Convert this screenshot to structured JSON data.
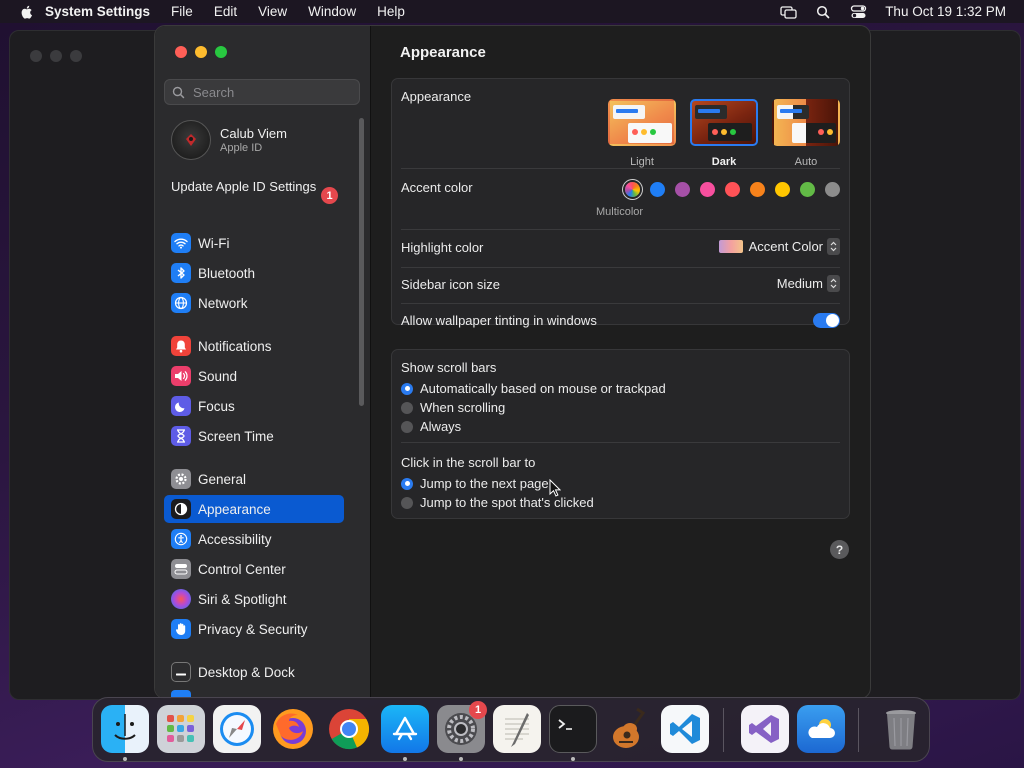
{
  "menubar": {
    "app_name": "System Settings",
    "menus": [
      "File",
      "Edit",
      "View",
      "Window",
      "Help"
    ],
    "clock": "Thu Oct 19  1:32 PM"
  },
  "sidebar": {
    "search_placeholder": "Search",
    "account": {
      "name": "Calub Viem",
      "subtitle": "Apple ID"
    },
    "update_notice": {
      "label": "Update Apple ID Settings",
      "badge": "1"
    },
    "items": [
      {
        "label": "Wi-Fi",
        "icon": "wifi-icon",
        "color": "#1f7ef5"
      },
      {
        "label": "Bluetooth",
        "icon": "bluetooth-icon",
        "color": "#1f7ef5"
      },
      {
        "label": "Network",
        "icon": "globe-icon",
        "color": "#1f7ef5"
      },
      {
        "label": "Notifications",
        "icon": "bell-icon",
        "color": "#f0433a"
      },
      {
        "label": "Sound",
        "icon": "speaker-icon",
        "color": "#ec3e6b"
      },
      {
        "label": "Focus",
        "icon": "moon-icon",
        "color": "#5e5ce6"
      },
      {
        "label": "Screen Time",
        "icon": "hourglass-icon",
        "color": "#5e5ce6"
      },
      {
        "label": "General",
        "icon": "gear-icon",
        "color": "#8e8e93"
      },
      {
        "label": "Appearance",
        "icon": "appearance-icon",
        "color": "#1c1c1e"
      },
      {
        "label": "Accessibility",
        "icon": "accessibility-icon",
        "color": "#1f7ef5"
      },
      {
        "label": "Control Center",
        "icon": "control-center-icon",
        "color": "#8e8e93"
      },
      {
        "label": "Siri & Spotlight",
        "icon": "siri-icon",
        "color": "#b14ad8"
      },
      {
        "label": "Privacy & Security",
        "icon": "hand-icon",
        "color": "#1f7ef5"
      },
      {
        "label": "Desktop & Dock",
        "icon": "dock-icon",
        "color": "#2c2c2e"
      }
    ],
    "active_item": "Appearance"
  },
  "content": {
    "title": "Appearance",
    "appearance": {
      "label": "Appearance",
      "options": [
        "Light",
        "Dark",
        "Auto"
      ],
      "selected": "Dark"
    },
    "accent": {
      "label": "Accent color",
      "selected_label": "Multicolor",
      "colors": [
        "#1f7ef5",
        "#a550a7",
        "#f74f9e",
        "#ff5257",
        "#f7821b",
        "#ffc600",
        "#62ba46",
        "#8c8c8c"
      ]
    },
    "highlight": {
      "label": "Highlight color",
      "value": "Accent Color"
    },
    "sidebar_icon_size": {
      "label": "Sidebar icon size",
      "value": "Medium"
    },
    "wallpaper_tinting": {
      "label": "Allow wallpaper tinting in windows",
      "enabled": true
    },
    "scroll_bars": {
      "label": "Show scroll bars",
      "options": [
        "Automatically based on mouse or trackpad",
        "When scrolling",
        "Always"
      ],
      "selected": "Automatically based on mouse or trackpad"
    },
    "click_scroll": {
      "label": "Click in the scroll bar to",
      "options": [
        "Jump to the next page",
        "Jump to the spot that's clicked"
      ],
      "selected": "Jump to the next page"
    },
    "help": "?"
  },
  "dock": {
    "apps": [
      "finder-icon",
      "launchpad-icon",
      "safari-icon",
      "firefox-icon",
      "chrome-icon",
      "app-store-icon",
      "system-settings-icon",
      "textedit-icon",
      "terminal-icon",
      "garageband-icon",
      "vscode-icon",
      "visual-studio-icon",
      "weather-icon",
      "trash-icon"
    ],
    "settings_badge": "1"
  }
}
